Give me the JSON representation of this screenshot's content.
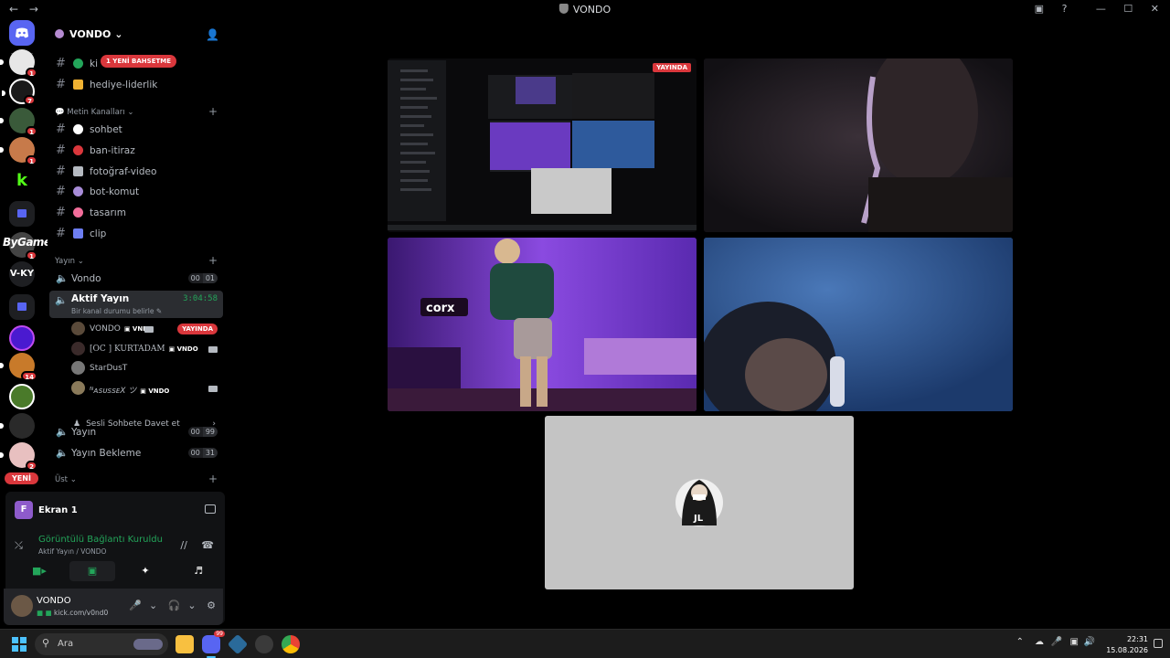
{
  "window": {
    "title": "VONDO",
    "nav_back": "←",
    "nav_fwd": "→",
    "min": "—",
    "max": "☐",
    "close": "✕",
    "help": "?",
    "inbox": "▣"
  },
  "rail": {
    "new_label": "YENİ",
    "overlay_text": "ByGame",
    "text_server": "V-KY",
    "badges": [
      "1",
      "7",
      "1",
      "1",
      "1",
      "1",
      "14",
      "2"
    ]
  },
  "server": {
    "name": "VONDO",
    "chevron": "⌄",
    "invite_icon": "person-add-icon",
    "mention_pill": "1 YENİ BAHSETME"
  },
  "channels_top": [
    {
      "label": "ki",
      "emoji_color": "#23a55a"
    },
    {
      "label": "hediye-liderlik",
      "emoji_color": "#f0b232"
    }
  ],
  "category_text": {
    "label": "Metin Kanalları",
    "chevron": "⌄"
  },
  "text_channels": [
    {
      "label": "sohbet",
      "emoji_color": "#ffffff"
    },
    {
      "label": "ban-itiraz",
      "emoji_color": "#da373c"
    },
    {
      "label": "fotoğraf-video",
      "emoji_color": "#b5bac1"
    },
    {
      "label": "bot-komut",
      "emoji_color": "#a88cd8"
    },
    {
      "label": "tasarım",
      "emoji_color": "#f26d9a"
    },
    {
      "label": "clip",
      "emoji_color": "#6d7ef2"
    }
  ],
  "category_stream": {
    "label": "Yayın",
    "chevron": "⌄"
  },
  "voice_vondo": {
    "label": "Vondo",
    "c1": "00",
    "c2": "01"
  },
  "active_voice": {
    "label": "Aktif Yayın",
    "time": "3:04:58",
    "status": "Bir kanal durumu belirle"
  },
  "members": [
    {
      "name": "VONDO",
      "tag": "VNDO",
      "live": "YAYINDA",
      "avatar": "#5a4a3a"
    },
    {
      "name": "[OC ] KURTADAM",
      "tag": "VNDO",
      "live": "",
      "avatar": "#3a2a2a"
    },
    {
      "name": "StarDusT",
      "tag": "",
      "live": "",
      "avatar": "#777"
    },
    {
      "name": "ᴺᴀꜱᴜꜱꜱᴇX ツ",
      "tag": "VNDO",
      "live": "",
      "avatar": "#8a7a5a"
    }
  ],
  "invite_row": {
    "label": "Sesli Sohbete Davet et",
    "chevron": "›"
  },
  "voice_others": [
    {
      "label": "Yayın",
      "c1": "00",
      "c2": "99"
    },
    {
      "label": "Yayın Bekleme",
      "c1": "00",
      "c2": "31"
    }
  ],
  "category_ust": {
    "label": "Üst",
    "chevron": "⌄"
  },
  "screen": {
    "letter": "F",
    "label": "Ekran 1"
  },
  "connection": {
    "title": "Görüntülü Bağlantı Kuruldu",
    "subtitle": "Aktif Yayın / VONDO"
  },
  "user": {
    "name": "VONDO",
    "status": "kick.com/v0nd0"
  },
  "grid": {
    "live_badge": "YAYINDA"
  },
  "taskbar": {
    "search_placeholder": "Ara",
    "time": "22:31",
    "date": "15.08.2026",
    "discord_badge": "99"
  },
  "colors": {
    "accent_green": "#23a55a",
    "live_red": "#da373c",
    "purple_room": "#7a3fd0",
    "blue_cam": "#2e5a9c"
  }
}
